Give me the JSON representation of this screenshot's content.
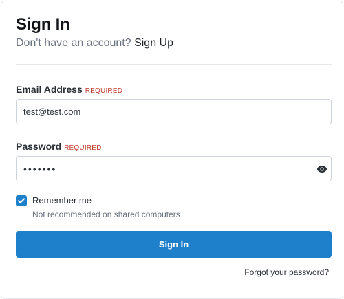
{
  "header": {
    "title": "Sign In",
    "subtitle_prefix": "Don't have an account?",
    "signup_link": "Sign Up"
  },
  "form": {
    "email": {
      "label": "Email Address",
      "required": "REQUIRED",
      "value": "test@test.com"
    },
    "password": {
      "label": "Password",
      "required": "REQUIRED",
      "value": "•••••••",
      "toggle_icon": "eye-icon"
    },
    "remember": {
      "label": "Remember me",
      "checked": true,
      "hint": "Not recommended on shared computers"
    },
    "submit_label": "Sign In",
    "forgot_link": "Forgot your password?"
  },
  "colors": {
    "primary": "#1e7fcb",
    "required": "#c0392b"
  }
}
